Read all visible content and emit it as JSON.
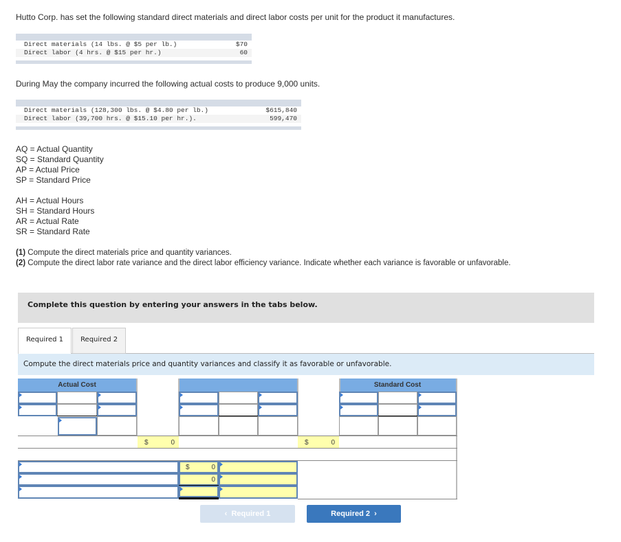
{
  "intro_text": "Hutto Corp. has set the following standard direct materials and direct labor costs per unit for the product it manufactures.",
  "standard_costs": {
    "rows": [
      {
        "label": "Direct materials (14 lbs. @ $5 per lb.)",
        "amount": "$70"
      },
      {
        "label": "Direct labor (4 hrs. @ $15 per hr.)",
        "amount": "60"
      }
    ]
  },
  "actual_intro": "During May the company incurred the following actual costs to produce 9,000 units.",
  "actual_costs": {
    "rows": [
      {
        "label": "Direct materials (128,300 lbs. @ $4.80 per lb.)",
        "amount": "$615,840"
      },
      {
        "label": "Direct labor (39,700 hrs. @ $15.10 per hr.).",
        "amount": "599,470"
      }
    ]
  },
  "legend_materials": [
    "AQ = Actual Quantity",
    "SQ = Standard Quantity",
    "AP = Actual Price",
    "SP = Standard Price"
  ],
  "legend_labor": [
    "AH = Actual Hours",
    "SH = Standard Hours",
    "AR = Actual Rate",
    "SR = Standard Rate"
  ],
  "instructions": {
    "part1_num": "(1)",
    "part1_text": " Compute the direct materials price and quantity variances.",
    "part2_num": "(2)",
    "part2_text": " Compute the direct labor rate variance and the direct labor efficiency variance. Indicate whether each variance is favorable or unfavorable."
  },
  "banner": "Complete this question by entering your answers in the tabs below.",
  "tabs": [
    {
      "label": "Required 1",
      "active": true
    },
    {
      "label": "Required 2",
      "active": false
    }
  ],
  "prompt": "Compute the direct materials price and quantity variances and classify it as favorable or unfavorable.",
  "grid": {
    "actual_cost_header": "Actual Cost",
    "middle_header": "",
    "standard_cost_header": "Standard Cost",
    "total1_currency": "$",
    "total1_value": "0",
    "total2_currency": "$",
    "total2_value": "0",
    "variance_rows": [
      {
        "currency": "$",
        "value": "0"
      },
      {
        "currency": "",
        "value": "0"
      },
      {
        "currency": "",
        "value": ""
      }
    ]
  },
  "nav": {
    "prev_label": "Required 1",
    "next_label": "Required 2",
    "prev_icon": "chevron-left",
    "next_icon": "chevron-right"
  }
}
